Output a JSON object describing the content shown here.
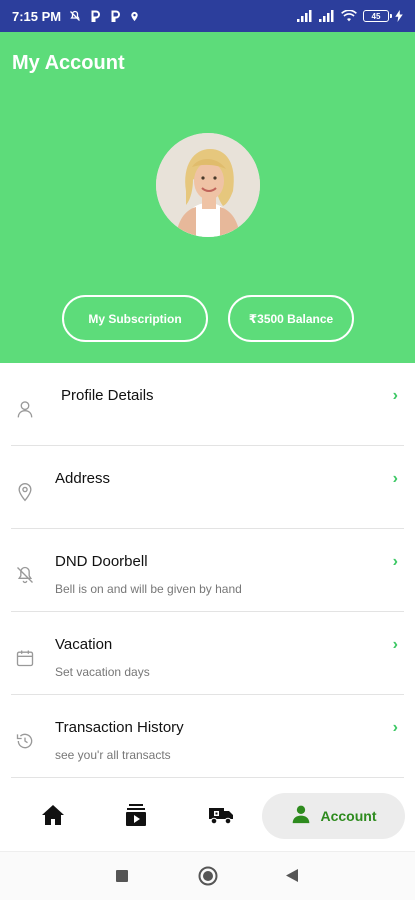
{
  "status_bar": {
    "time": "7:15 PM",
    "battery": "45",
    "icons": [
      "mute-icon",
      "p-app-icon",
      "p-app-icon",
      "location-icon",
      "signal-icon",
      "signal-icon",
      "wifi-icon",
      "battery-icon",
      "charging-icon"
    ]
  },
  "header": {
    "title": "My Account",
    "background_color": "#5ddc7a",
    "subscription_button": "My Subscription",
    "balance_button": "₹3500 Balance"
  },
  "menu": [
    {
      "icon": "user-icon",
      "title": "Profile Details",
      "subtitle": ""
    },
    {
      "icon": "location-pin-icon",
      "title": "Address",
      "subtitle": ""
    },
    {
      "icon": "bell-off-icon",
      "title": "DND Doorbell",
      "subtitle": "Bell is on and will be given by hand"
    },
    {
      "icon": "calendar-icon",
      "title": "Vacation",
      "subtitle": "Set vacation days"
    },
    {
      "icon": "history-icon",
      "title": "Transaction History",
      "subtitle": "see you'r all transacts"
    }
  ],
  "bottom_nav": {
    "items": [
      "home-icon",
      "video-library-icon",
      "delivery-truck-icon"
    ],
    "active_label": "Account",
    "active_color": "#2e8b1e"
  },
  "system_nav": [
    "recent-apps-icon",
    "home-circle-icon",
    "back-icon"
  ]
}
